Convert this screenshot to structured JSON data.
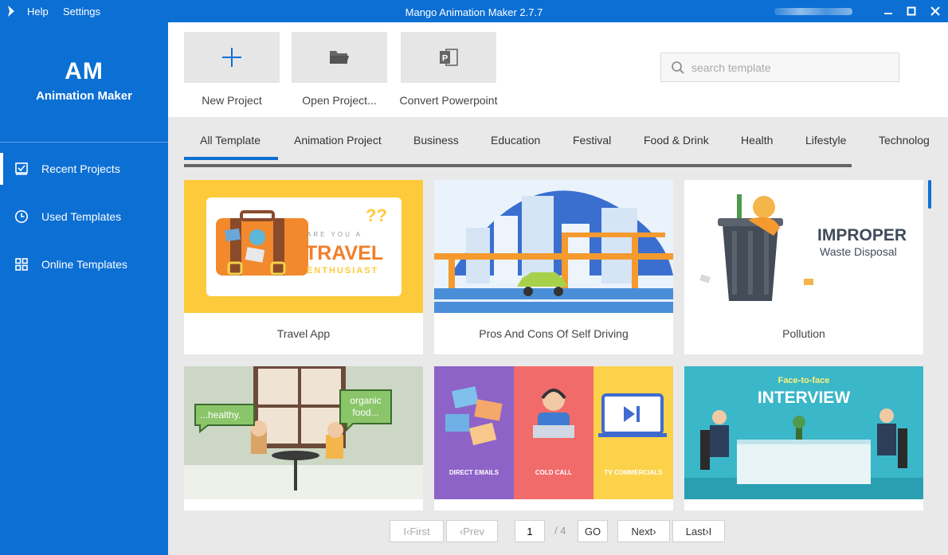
{
  "window": {
    "title": "Mango Animation Maker 2.7.7",
    "menu": [
      "Help",
      "Settings"
    ]
  },
  "sidebar": {
    "brand_short": "AM",
    "brand_name": "Animation Maker",
    "items": [
      {
        "label": "Recent Projects",
        "icon": "checkbox-icon",
        "active": true
      },
      {
        "label": "Used Templates",
        "icon": "clock-icon",
        "active": false
      },
      {
        "label": "Online Templates",
        "icon": "grid-icon",
        "active": false
      }
    ]
  },
  "actions": [
    {
      "label": "New Project",
      "icon": "plus-icon"
    },
    {
      "label": "Open Project...",
      "icon": "folder-icon"
    },
    {
      "label": "Convert Powerpoint",
      "icon": "powerpoint-icon"
    }
  ],
  "search": {
    "placeholder": "search template",
    "value": ""
  },
  "tabs": [
    "All Template",
    "Animation Project",
    "Business",
    "Education",
    "Festival",
    "Food & Drink",
    "Health",
    "Lifestyle",
    "Technolog"
  ],
  "active_tab": "All Template",
  "templates": [
    {
      "title": "Travel App",
      "thumb": {
        "lines": [
          "ARE YOU A",
          "TRAVEL",
          "ENTHUSIAST"
        ]
      }
    },
    {
      "title": "Pros And Cons Of Self Driving",
      "thumb": {
        "lines": []
      }
    },
    {
      "title": "Pollution",
      "thumb": {
        "lines": [
          "IMPROPER",
          "Waste Disposal"
        ]
      }
    },
    {
      "title": "",
      "thumb": {
        "lines": [
          "...healthy.",
          "organic food..."
        ]
      }
    },
    {
      "title": "",
      "thumb": {
        "lines": [
          "DIRECT EMAILS",
          "COLD CALL",
          "TV COMMERCIALS"
        ]
      }
    },
    {
      "title": "",
      "thumb": {
        "lines": [
          "Face-to-face",
          "INTERVIEW"
        ]
      }
    }
  ],
  "pagination": {
    "first": "First",
    "prev": "Prev",
    "current": "1",
    "total": "/ 4",
    "go": "GO",
    "next": "Next",
    "last": "Last"
  },
  "colors": {
    "accent": "#0c6fd4"
  }
}
